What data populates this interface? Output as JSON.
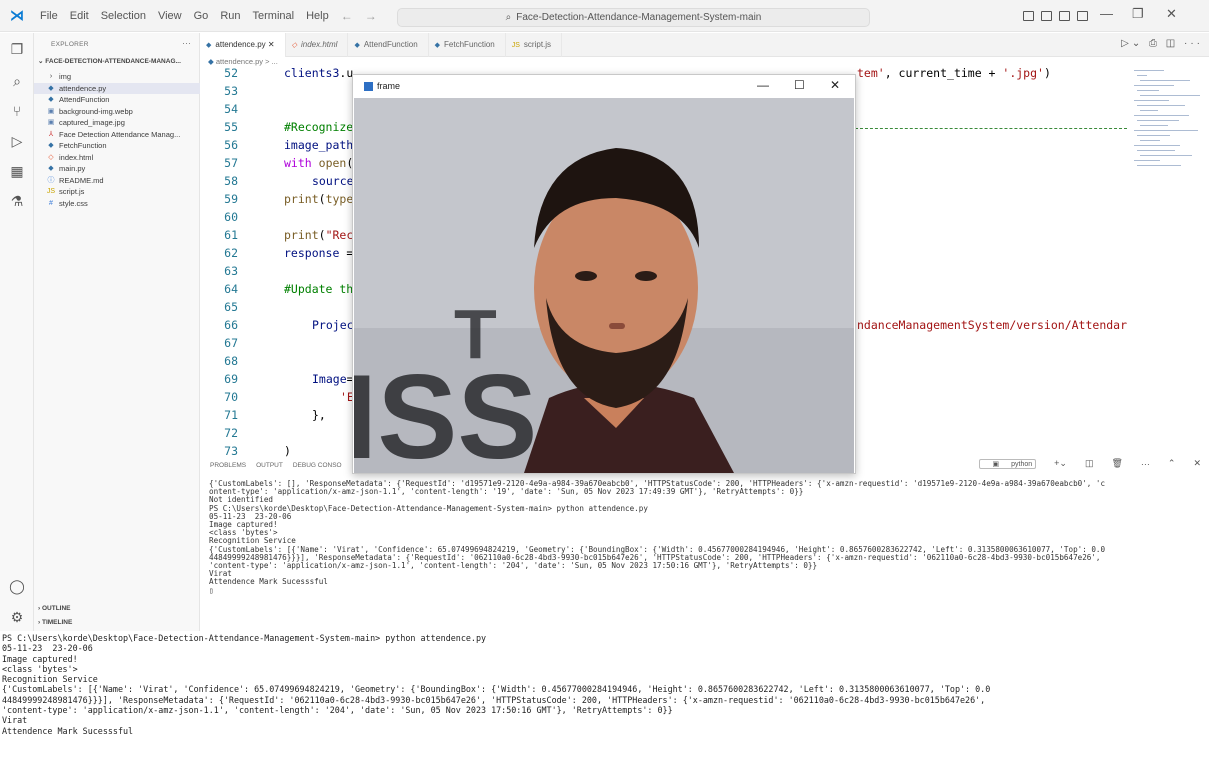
{
  "titlebar": {
    "menus": [
      "File",
      "Edit",
      "Selection",
      "View",
      "Go",
      "Run",
      "Terminal",
      "Help"
    ],
    "search": "Face-Detection-Attendance-Management-System-main"
  },
  "sidebar": {
    "header": "EXPLORER",
    "root": "FACE-DETECTION-ATTENDANCE-MANAG...",
    "items": [
      {
        "label": "img",
        "icon": ">"
      },
      {
        "label": "attendence.py",
        "icon": "py"
      },
      {
        "label": "AttendFunction",
        "icon": "fn"
      },
      {
        "label": "background-img.webp",
        "icon": "img"
      },
      {
        "label": "captured_image.jpg",
        "icon": "img"
      },
      {
        "label": "Face Detection Attendance Manag...",
        "icon": "pdf"
      },
      {
        "label": "FetchFunction",
        "icon": "fn"
      },
      {
        "label": "index.html",
        "icon": "html"
      },
      {
        "label": "main.py",
        "icon": "py"
      },
      {
        "label": "README.md",
        "icon": "md"
      },
      {
        "label": "script.js",
        "icon": "js"
      },
      {
        "label": "style.css",
        "icon": "css"
      }
    ],
    "outline": "OUTLINE",
    "timeline": "TIMELINE"
  },
  "tabs": [
    {
      "label": "attendence.py",
      "active": true
    },
    {
      "label": "index.html",
      "active": false
    },
    {
      "label": "AttendFunction",
      "active": false
    },
    {
      "label": "FetchFunction",
      "active": false
    },
    {
      "label": "script.js",
      "active": false
    }
  ],
  "breadcrumb": "attendence.py > ...",
  "editor": {
    "line_numbers": [
      "52",
      "53",
      "54",
      "55",
      "56",
      "57",
      "58",
      "59",
      "60",
      "61",
      "62",
      "63",
      "64",
      "65",
      "66",
      "67",
      "68",
      "69",
      "70",
      "71",
      "72",
      "73"
    ]
  },
  "frame_window": {
    "title": "frame"
  },
  "panel": {
    "tabs": [
      "PROBLEMS",
      "OUTPUT",
      "DEBUG CONSO"
    ],
    "terminal_label": "python",
    "lines": [
      "{'CustomLabels': [], 'ResponseMetadata': {'RequestId': 'd19571e9-2120-4e9a-a984-39a670eabcb0', 'HTTPStatusCode': 200, 'HTTPHeaders': {'x-amzn-requestid': 'd19571e9-2120-4e9a-a984-39a670eabcb0', 'c",
      "ontent-type': 'application/x-amz-json-1.1', 'content-length': '19', 'date': 'Sun, 05 Nov 2023 17:49:39 GMT'}, 'RetryAttempts': 0}}",
      "Not identified",
      "PS C:\\Users\\korde\\Desktop\\Face-Detection-Attendance-Management-System-main> python attendence.py",
      "05-11-23  23-20-06",
      "Image captured!",
      "<class 'bytes'>",
      "Recognition Service",
      "{'CustomLabels': [{'Name': 'Virat', 'Confidence': 65.07499694824219, 'Geometry': {'BoundingBox': {'Width': 0.45677000284194946, 'Height': 0.8657600283622742, 'Left': 0.3135800063610077, 'Top': 0.0",
      "44849999248981476}}}], 'ResponseMetadata': {'RequestId': '062110a0-6c28-4bd3-9930-bc015b647e26', 'HTTPStatusCode': 200, 'HTTPHeaders': {'x-amzn-requestid': '062110a0-6c28-4bd3-9930-bc015b647e26',",
      "'content-type': 'application/x-amz-json-1.1', 'content-length': '204', 'date': 'Sun, 05 Nov 2023 17:50:16 GMT'}, 'RetryAttempts': 0}}",
      "Virat",
      "Attendence Mark Sucesssful",
      "▯"
    ]
  },
  "console": {
    "lines": [
      "PS C:\\Users\\korde\\Desktop\\Face-Detection-Attendance-Management-System-main> python attendence.py",
      "05-11-23  23-20-06",
      "Image captured!",
      "<class 'bytes'>",
      "Recognition Service",
      "{'CustomLabels': [{'Name': 'Virat', 'Confidence': 65.07499694824219, 'Geometry': {'BoundingBox': {'Width': 0.45677000284194946, 'Height': 0.8657600283622742, 'Left': 0.3135800063610077, 'Top': 0.0",
      "44849999248981476}}}], 'ResponseMetadata': {'RequestId': '062110a0-6c28-4bd3-9930-bc015b647e26', 'HTTPStatusCode': 200, 'HTTPHeaders': {'x-amzn-requestid': '062110a0-6c28-4bd3-9930-bc015b647e26',",
      "'content-type': 'application/x-amz-json-1.1', 'content-length': '204', 'date': 'Sun, 05 Nov 2023 17:50:16 GMT'}, 'RetryAttempts': 0}}",
      "Virat",
      "Attendence Mark Sucesssful"
    ]
  },
  "colors": {
    "accent": "#0a7bd4",
    "line_number": "#237893",
    "keyword": "#af00db",
    "comment": "#008000",
    "string": "#a31515"
  }
}
